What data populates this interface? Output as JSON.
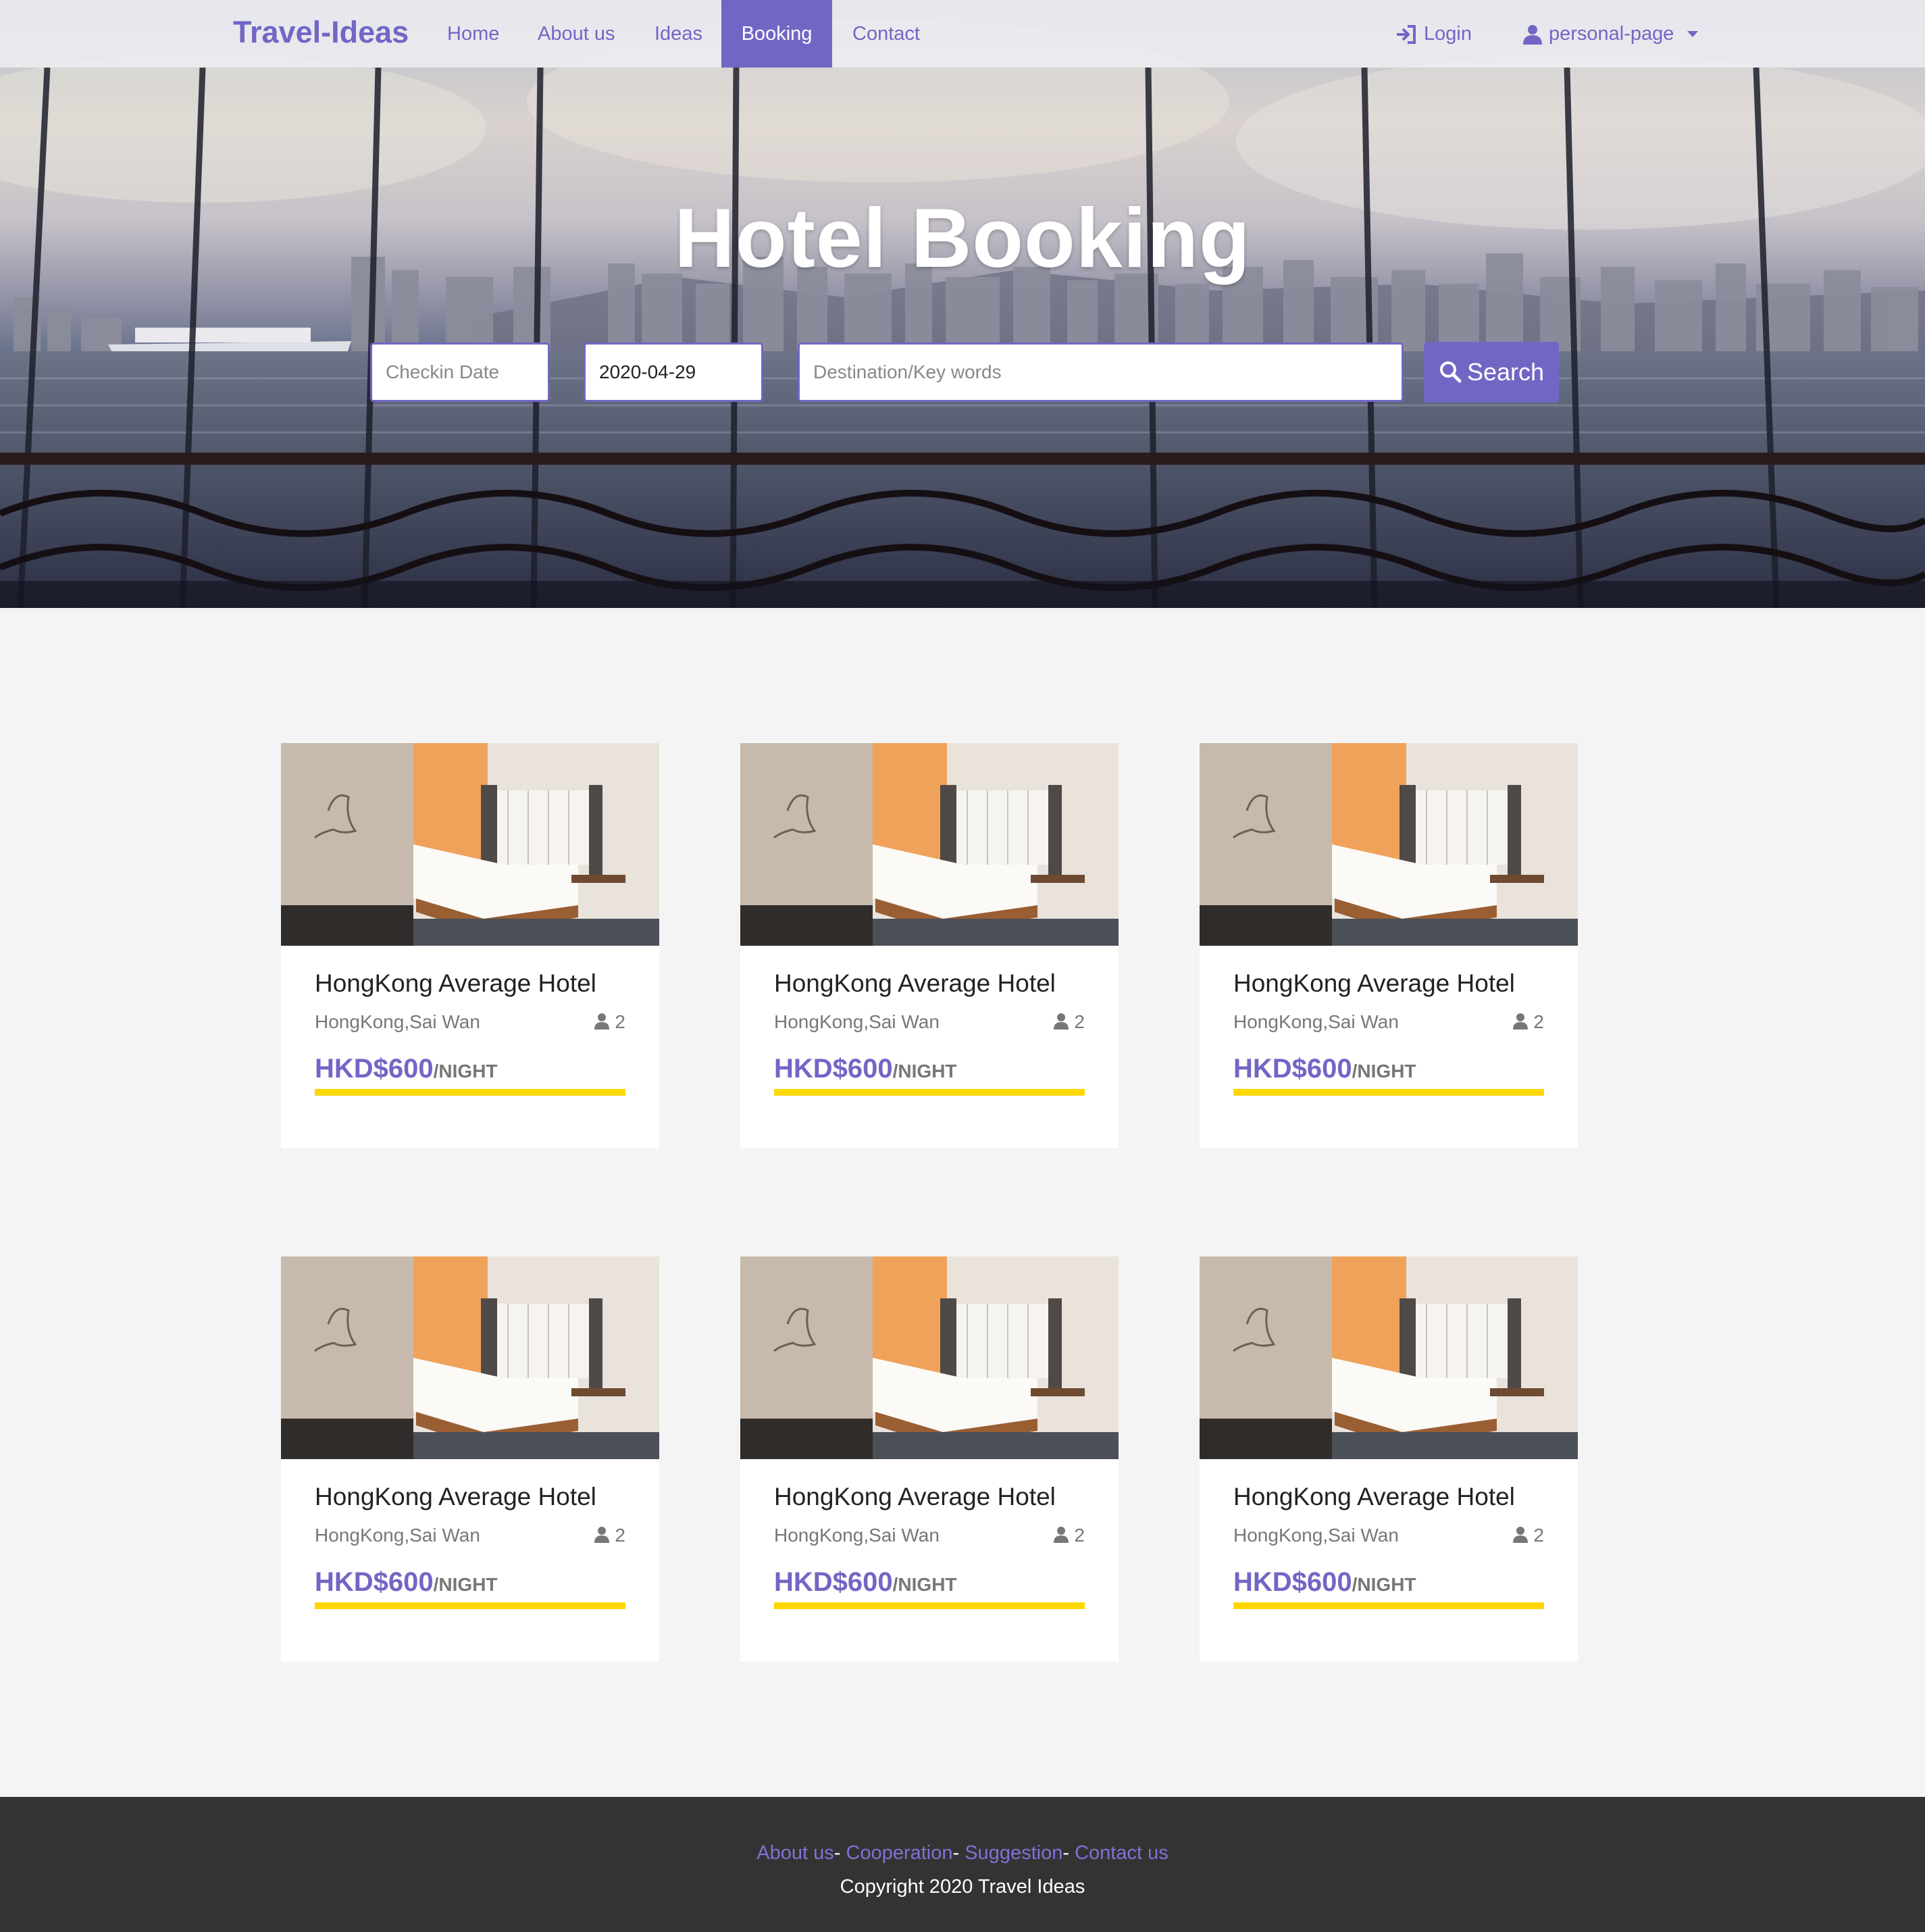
{
  "nav": {
    "brand": "Travel-Ideas",
    "items": [
      {
        "label": "Home",
        "active": false
      },
      {
        "label": "About us",
        "active": false
      },
      {
        "label": "Ideas",
        "active": false
      },
      {
        "label": "Booking",
        "active": true
      },
      {
        "label": "Contact",
        "active": false
      }
    ],
    "login_label": "Login",
    "login_icon": "sign-in-icon",
    "user_label": "personal-page",
    "user_icon": "user-icon",
    "user_caret_icon": "caret-down-icon"
  },
  "hero": {
    "title": "Hotel Booking",
    "checkin_placeholder": "Checkin Date",
    "checkout_value": "2020-04-29",
    "destination_placeholder": "Destination/Key words",
    "search_label": "Search",
    "search_icon": "search-icon"
  },
  "hotels": [
    {
      "name": "HongKong Average Hotel",
      "location": "HongKong,Sai Wan",
      "guests": "2",
      "price": "HKD$600",
      "per": "/NIGHT"
    },
    {
      "name": "HongKong Average Hotel",
      "location": "HongKong,Sai Wan",
      "guests": "2",
      "price": "HKD$600",
      "per": "/NIGHT"
    },
    {
      "name": "HongKong Average Hotel",
      "location": "HongKong,Sai Wan",
      "guests": "2",
      "price": "HKD$600",
      "per": "/NIGHT"
    },
    {
      "name": "HongKong Average Hotel",
      "location": "HongKong,Sai Wan",
      "guests": "2",
      "price": "HKD$600",
      "per": "/NIGHT"
    },
    {
      "name": "HongKong Average Hotel",
      "location": "HongKong,Sai Wan",
      "guests": "2",
      "price": "HKD$600",
      "per": "/NIGHT"
    },
    {
      "name": "HongKong Average Hotel",
      "location": "HongKong,Sai Wan",
      "guests": "2",
      "price": "HKD$600",
      "per": "/NIGHT"
    }
  ],
  "footer": {
    "links": [
      "About us",
      "Cooperation",
      "Suggestion",
      "Contact us"
    ],
    "separator": "-",
    "copyright": "Copyright 2020 Travel Ideas"
  },
  "colors": {
    "accent": "#7266c5",
    "price_bar": "#ffd700",
    "footer_bg": "#333333",
    "page_bg": "#f4f4f4"
  }
}
